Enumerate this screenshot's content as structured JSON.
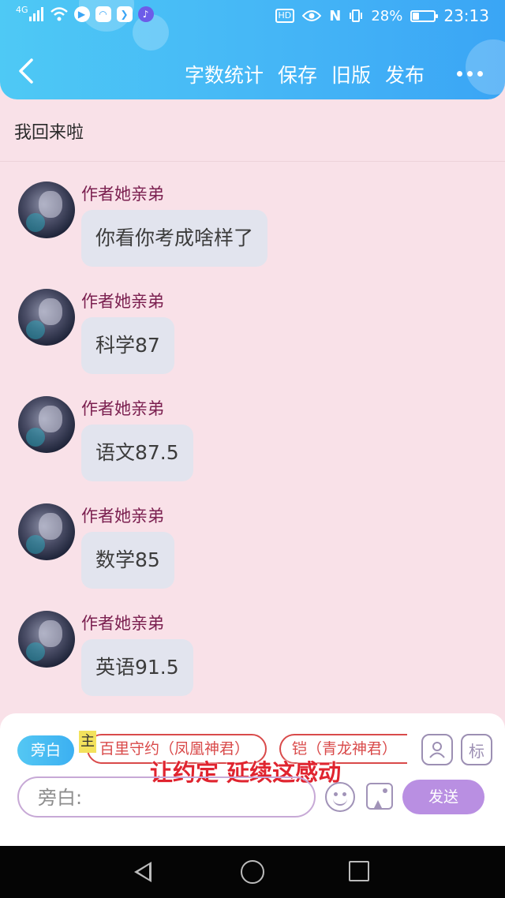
{
  "status_bar": {
    "network": "4G",
    "battery_percent": "28%",
    "battery_level": 0.28,
    "time": "23:13",
    "hd_label": "HD",
    "icons": [
      "signal-icon",
      "wifi-icon",
      "play-app-icon",
      "app-icon",
      "bookmark-app-icon",
      "music-app-icon",
      "eye-icon",
      "nfc-icon",
      "vibrate-icon",
      "battery-icon"
    ]
  },
  "header": {
    "back_icon": "chevron-left-icon",
    "actions": [
      "字数统计",
      "保存",
      "旧版",
      "发布"
    ],
    "more_icon": "more-dots-icon",
    "accent_color": "#44b4f6"
  },
  "title": "我回来啦",
  "messages": [
    {
      "author": "作者她亲弟",
      "text": "你看你考成啥样了"
    },
    {
      "author": "作者她亲弟",
      "text": "科学87"
    },
    {
      "author": "作者她亲弟",
      "text": "语文87.5"
    },
    {
      "author": "作者她亲弟",
      "text": "数学85"
    },
    {
      "author": "作者她亲弟",
      "text": "英语91.5"
    }
  ],
  "composer": {
    "narration_chip": "旁白",
    "master_tag": "主",
    "roles": [
      "百里守约（凤凰神君）",
      "铠（青龙神君）"
    ],
    "role_icon": "person-card-icon",
    "tag_button": "标",
    "overlay_caption": "让约定 延续这感动",
    "input_placeholder": "旁白:",
    "emoji_icon": "emoji-icon",
    "image_icon": "image-icon",
    "send_label": "发送",
    "send_color": "#b98fe2"
  },
  "system_nav": {
    "icons": [
      "back-triangle-icon",
      "home-circle-icon",
      "recent-square-icon"
    ]
  }
}
